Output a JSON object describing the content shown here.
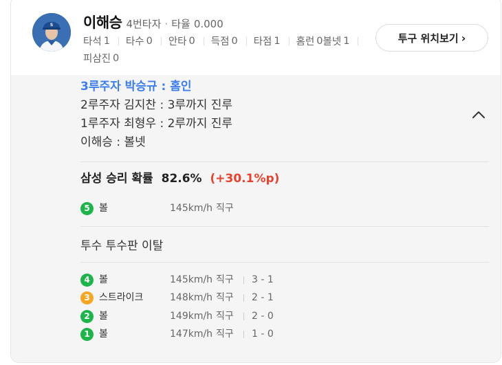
{
  "player": {
    "name": "이해승",
    "batting_order": "4번타자",
    "avg_label": "타율",
    "avg_value": "0.000",
    "stats": [
      {
        "label": "타석",
        "value": "1"
      },
      {
        "label": "타수",
        "value": "0"
      },
      {
        "label": "안타",
        "value": "0"
      },
      {
        "label": "득점",
        "value": "0"
      },
      {
        "label": "타점",
        "value": "1"
      },
      {
        "label": "홈런",
        "value": "0"
      },
      {
        "label": "볼넷",
        "value": "1"
      },
      {
        "label": "피삼진",
        "value": "0"
      }
    ]
  },
  "pitch_button": {
    "label": "투구 위치보기",
    "chevron": "›"
  },
  "events": [
    "3루주자 박승규 : 홈인",
    "2루주자 김지찬 : 3루까지 진루",
    "1루주자 최형우 : 2루까지 진루",
    "이해승 : 볼넷"
  ],
  "win_probability": {
    "team_label": "삼성 승리 확률",
    "value": "82.6%",
    "delta": "(+30.1%p)"
  },
  "pitch_5": {
    "number": "5",
    "result": "볼",
    "speed": "145km/h",
    "type": "직구"
  },
  "pitcher_note": "투수 투수판 이탈",
  "pitches": [
    {
      "number": "4",
      "result": "볼",
      "speed": "145km/h",
      "type": "직구",
      "count": "3 - 1",
      "kind": "ball"
    },
    {
      "number": "3",
      "result": "스트라이크",
      "speed": "148km/h",
      "type": "직구",
      "count": "2 - 1",
      "kind": "strike"
    },
    {
      "number": "2",
      "result": "볼",
      "speed": "149km/h",
      "type": "직구",
      "count": "2 - 0",
      "kind": "ball"
    },
    {
      "number": "1",
      "result": "볼",
      "speed": "147km/h",
      "type": "직구",
      "count": "1 - 0",
      "kind": "ball"
    }
  ],
  "colors": {
    "highlight": "#3b7ded",
    "delta": "#e8412c",
    "ball": "#1db54a",
    "strike": "#f5a623",
    "panel": "#f5f5f5"
  },
  "icons": {
    "avatar": "player-photo",
    "collapse": "chevron-up-icon",
    "button_chevron": "chevron-right-icon"
  }
}
